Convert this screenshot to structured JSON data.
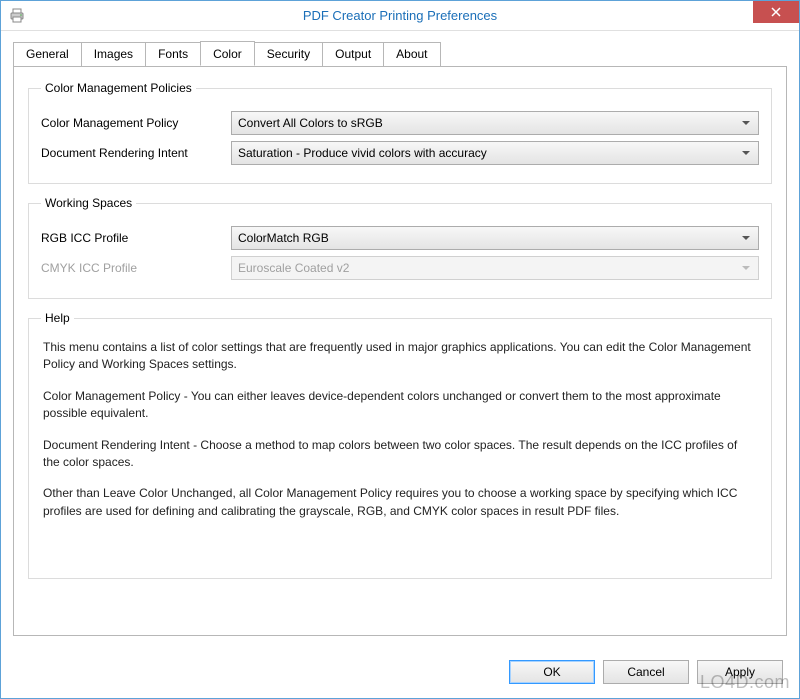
{
  "window": {
    "title": "PDF Creator Printing Preferences"
  },
  "tabs": {
    "items": [
      {
        "label": "General"
      },
      {
        "label": "Images"
      },
      {
        "label": "Fonts"
      },
      {
        "label": "Color",
        "active": true
      },
      {
        "label": "Security"
      },
      {
        "label": "Output"
      },
      {
        "label": "About"
      }
    ]
  },
  "groups": {
    "cmp": {
      "legend": "Color Management Policies",
      "policy_label": "Color Management Policy",
      "policy_value": "Convert All Colors to sRGB",
      "intent_label": "Document Rendering Intent",
      "intent_value": "Saturation - Produce vivid colors with accuracy"
    },
    "ws": {
      "legend": "Working Spaces",
      "rgb_label": "RGB ICC Profile",
      "rgb_value": "ColorMatch RGB",
      "cmyk_label": "CMYK ICC Profile",
      "cmyk_value": "Euroscale Coated v2",
      "cmyk_disabled": true
    },
    "help": {
      "legend": "Help",
      "p1": "This menu contains a list of color settings that are frequently used in major graphics applications. You can edit the Color Management Policy and Working Spaces settings.",
      "p2": "Color Management Policy - You can either leaves device-dependent colors unchanged or convert them to the most approximate possible equivalent.",
      "p3": "Document Rendering Intent - Choose a method to map colors between two color spaces. The result depends on the ICC profiles of the color spaces.",
      "p4": "Other than Leave Color Unchanged, all Color Management Policy requires you to choose a working space by specifying which ICC profiles are used for defining and calibrating the grayscale, RGB, and CMYK color spaces in result PDF files."
    }
  },
  "buttons": {
    "ok": "OK",
    "cancel": "Cancel",
    "apply": "Apply"
  },
  "watermark": "LO4D.com"
}
